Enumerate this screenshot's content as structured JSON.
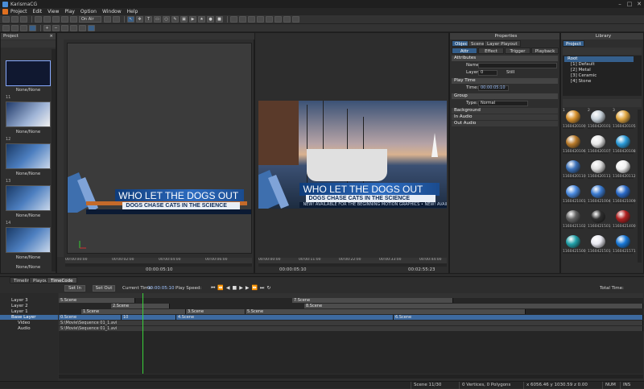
{
  "app": {
    "title": "KarismaCG"
  },
  "menu": [
    "Project",
    "Edit",
    "View",
    "Play",
    "Option",
    "Window",
    "Help"
  ],
  "toolbar": {
    "mode_select": "On Air"
  },
  "project_panel": {
    "title": "Project",
    "items": [
      {
        "num": "",
        "label": "None/None"
      },
      {
        "num": "11",
        "label": "None/None"
      },
      {
        "num": "12",
        "label": "None/None"
      },
      {
        "num": "13",
        "label": "None/None"
      },
      {
        "num": "14",
        "label": "None/None"
      },
      {
        "num": "",
        "label": "None/None"
      }
    ]
  },
  "viewport_left": {
    "headline": "WHO LET THE DOGS OUT",
    "subline": "DOGS CHASE CATS IN THE SCIENCE",
    "ruler_labels": [
      "00:00:00:00",
      "00:00:02:00",
      "00:00:04:00",
      "00:00:06:00",
      "00:00:08:00"
    ],
    "timecode": "00:00:05:10"
  },
  "viewport_right": {
    "headline": "WHO LET THE DOGS OUT",
    "subline": "DOGS CHASE CATS IN THE SCIENCE",
    "ticker": "NEW! AVAILABLE FOR THE BEGINNING MOTION GRAPHICS  • NEW! AVAILABLE",
    "ruler_labels": [
      "00:00:00:00",
      "00:00:11:00",
      "00:00:22:00",
      "00:00:33:00",
      "00:00:44:00"
    ],
    "timecode_left": "00:00:05:10",
    "timecode_right": "00:02:55:23"
  },
  "properties": {
    "title": "Properties",
    "tabs": [
      "Object",
      "Scene",
      "Layer Playout"
    ],
    "subtabs": [
      "Attr",
      "Effect",
      "Trigger",
      "Playback"
    ],
    "attributes": {
      "header": "Attributes",
      "name_label": "Name:",
      "name_value": "",
      "layer_label": "Layer:",
      "layer_value": "0",
      "still_label": "Still"
    },
    "play_time": {
      "header": "Play Time",
      "time_label": "Time:",
      "time_value": "00:00:05:10"
    },
    "group": {
      "header": "Group",
      "type_label": "Type:",
      "type_value": "Normal",
      "items": [
        "Background",
        "In Audio",
        "Out Audio"
      ]
    }
  },
  "library": {
    "title": "Library",
    "tab": "Project",
    "tree": [
      {
        "label": "Root",
        "root": true
      },
      {
        "label": "[1] Default"
      },
      {
        "label": "[2] Metal"
      },
      {
        "label": "[3] Ceramic"
      },
      {
        "label": "[4] Stone"
      }
    ],
    "materials": [
      {
        "num": "1",
        "label": "1160420100",
        "color": "#d8922e"
      },
      {
        "num": "2",
        "label": "1160420101",
        "color": "#c8d2da"
      },
      {
        "num": "3",
        "label": "1160420105",
        "color": "#e0a640"
      },
      {
        "num": "",
        "label": "1160420106",
        "color": "#b87a2a"
      },
      {
        "num": "",
        "label": "1160420107",
        "color": "#e8e8e8"
      },
      {
        "num": "",
        "label": "1160420108",
        "color": "#2a9ad8"
      },
      {
        "num": "",
        "label": "1160420110",
        "color": "#3a70b8"
      },
      {
        "num": "",
        "label": "1160420111",
        "color": "#dcdcdc"
      },
      {
        "num": "",
        "label": "1160420112",
        "color": "#f0f0f0"
      },
      {
        "num": "",
        "label": "1160421001",
        "color": "#4a8ae0"
      },
      {
        "num": "",
        "label": "1160421004",
        "color": "#3a7ad0"
      },
      {
        "num": "",
        "label": "1160421009",
        "color": "#2a6ac8"
      },
      {
        "num": "",
        "label": "1160421102",
        "color": "#606060"
      },
      {
        "num": "",
        "label": "1160421501",
        "color": "#2e2e2e"
      },
      {
        "num": "",
        "label": "1160421400",
        "color": "#b02020"
      },
      {
        "num": "",
        "label": "1160421500",
        "color": "#20a0a8"
      },
      {
        "num": "",
        "label": "1160421501",
        "color": "#e8e8f0"
      },
      {
        "num": "",
        "label": "1160421571",
        "color": "#1878d8"
      }
    ]
  },
  "timeline": {
    "tabs": [
      "Timeline",
      "Playout",
      "TimeCode"
    ],
    "set_in": "Set In",
    "set_out": "Set Out",
    "current_time_label": "Current Time:",
    "current_time_value": "00:00:05:10",
    "play_speed_label": "Play Speed:",
    "total_time_label": "Total Time:",
    "layers": [
      {
        "name": "Layer 3"
      },
      {
        "name": "Layer 2"
      },
      {
        "name": "Layer 1"
      },
      {
        "name": "Base Layer",
        "selected": true
      },
      {
        "name": "Video"
      },
      {
        "name": "Audio"
      }
    ],
    "clips": [
      {
        "row": 0,
        "start": 0,
        "end": 95,
        "label": "5.Scene",
        "style": "gray"
      },
      {
        "row": 0,
        "start": 290,
        "end": 490,
        "label": "7.Scene",
        "style": "gray"
      },
      {
        "row": 1,
        "start": 65,
        "end": 138,
        "label": "2.Scene",
        "style": "gray"
      },
      {
        "row": 1,
        "start": 305,
        "end": 726,
        "label": "8.Scene",
        "style": "gray"
      },
      {
        "row": 2,
        "start": 28,
        "end": 158,
        "label": "1.Scene",
        "style": "gray"
      },
      {
        "row": 2,
        "start": 158,
        "end": 232,
        "label": "3.Scene",
        "style": "gray"
      },
      {
        "row": 2,
        "start": 232,
        "end": 580,
        "label": "5.Scene",
        "style": "gray"
      },
      {
        "row": 3,
        "start": 0,
        "end": 78,
        "label": "0.Scene",
        "style": "blue"
      },
      {
        "row": 3,
        "start": 78,
        "end": 146,
        "label": "10",
        "style": "blue"
      },
      {
        "row": 3,
        "start": 146,
        "end": 416,
        "label": "4.Scene",
        "style": "blue"
      },
      {
        "row": 3,
        "start": 416,
        "end": 726,
        "label": "6.Scene",
        "style": "blue"
      },
      {
        "row": 4,
        "start": 0,
        "end": 726,
        "label": "S:\\Movie\\Sequence 01_1.avi",
        "style": "file"
      },
      {
        "row": 5,
        "start": 0,
        "end": 726,
        "label": "S:\\Movie\\Sequence 01_1.avi",
        "style": "file"
      }
    ]
  },
  "status": {
    "scene": "Scene 11/30",
    "geometry": "0 Vertices, 0 Polygons",
    "coords": "x 6056.46  y 1030.59  z 0.00",
    "num": "NUM",
    "ins": "INS"
  }
}
